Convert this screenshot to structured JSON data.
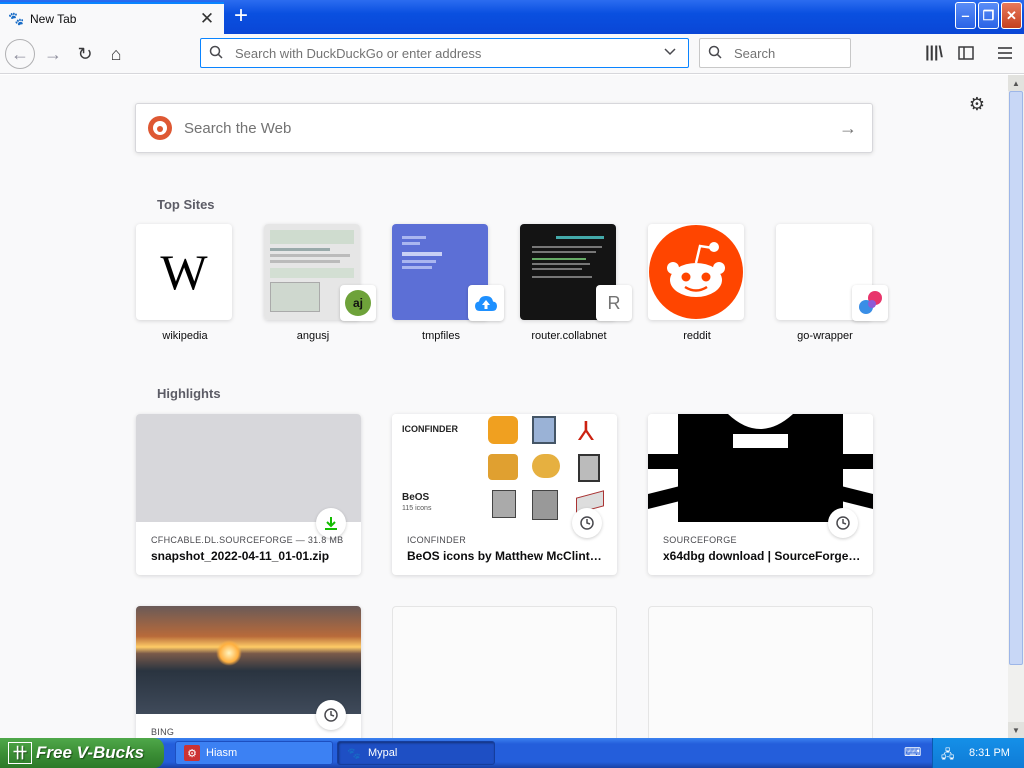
{
  "window": {
    "tab_title": "New Tab",
    "tab_close": "✕",
    "new_tab": "+",
    "minimize": "‒",
    "maximize": "❐",
    "close": "✕"
  },
  "navbar": {
    "url_placeholder": "Search with DuckDuckGo or enter address",
    "search_placeholder": "Search",
    "icons": [
      "back-icon",
      "forward-icon",
      "reload-icon",
      "home-icon",
      "library-icon",
      "sidebars-icon",
      "menu-icon"
    ]
  },
  "content": {
    "web_search_placeholder": "Search the Web",
    "top_sites_title": "Top Sites",
    "highlights_title": "Highlights",
    "top_sites": [
      {
        "label": "wikipedia"
      },
      {
        "label": "angusj",
        "badge": "aj"
      },
      {
        "label": "tmpfiles"
      },
      {
        "label": "router.collabnet",
        "badge": "R"
      },
      {
        "label": "reddit"
      },
      {
        "label": "go-wrapper"
      }
    ],
    "highlights": [
      {
        "source": "CFHCABLE.DL.SOURCEFORGE — 31.8 MB",
        "title": "snapshot_2022-04-11_01-01.zip",
        "icon": "download-icon"
      },
      {
        "source": "ICONFINDER",
        "title": "BeOS icons by Matthew McClint…",
        "icon": "clock-icon",
        "thumb_brand": "ICONFINDER",
        "thumb_caption": "BeOS",
        "thumb_sub": "115 icons"
      },
      {
        "source": "SOURCEFORGE",
        "title": "x64dbg download | SourceForge…",
        "icon": "clock-icon"
      },
      {
        "source": "BING",
        "title": "",
        "icon": "clock-icon"
      }
    ]
  },
  "taskbar": {
    "start_label": "Free V-Bucks",
    "tasks": [
      {
        "label": "Hiasm"
      },
      {
        "label": "Mypal"
      }
    ],
    "clock": "8:31 PM"
  }
}
